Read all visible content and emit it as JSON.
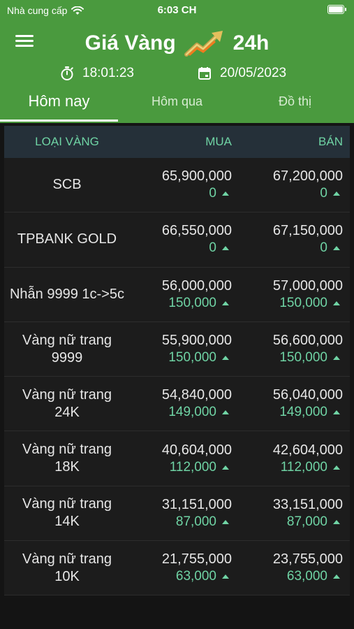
{
  "status_bar": {
    "carrier": "Nhà cung cấp",
    "time": "6:03 CH"
  },
  "header": {
    "title_left": "Giá Vàng",
    "title_right": "24h",
    "clock_time": "18:01:23",
    "date": "20/05/2023"
  },
  "tabs": [
    {
      "label": "Hôm nay"
    },
    {
      "label": "Hôm qua"
    },
    {
      "label": "Đồ thị"
    }
  ],
  "table": {
    "headers": {
      "type": "LOẠI VÀNG",
      "buy": "MUA",
      "sell": "BÁN"
    },
    "rows": [
      {
        "type": "SCB",
        "buy": "65,900,000",
        "buy_change": "0",
        "sell": "67,200,000",
        "sell_change": "0"
      },
      {
        "type": "TPBANK GOLD",
        "buy": "66,550,000",
        "buy_change": "0",
        "sell": "67,150,000",
        "sell_change": "0"
      },
      {
        "type": "Nhẫn 9999 1c->5c",
        "buy": "56,000,000",
        "buy_change": "150,000",
        "sell": "57,000,000",
        "sell_change": "150,000"
      },
      {
        "type": "Vàng nữ trang 9999",
        "buy": "55,900,000",
        "buy_change": "150,000",
        "sell": "56,600,000",
        "sell_change": "150,000"
      },
      {
        "type": "Vàng nữ trang 24K",
        "buy": "54,840,000",
        "buy_change": "149,000",
        "sell": "56,040,000",
        "sell_change": "149,000"
      },
      {
        "type": "Vàng nữ trang 18K",
        "buy": "40,604,000",
        "buy_change": "112,000",
        "sell": "42,604,000",
        "sell_change": "112,000"
      },
      {
        "type": "Vàng nữ trang 14K",
        "buy": "31,151,000",
        "buy_change": "87,000",
        "sell": "33,151,000",
        "sell_change": "87,000"
      },
      {
        "type": "Vàng nữ trang 10K",
        "buy": "21,755,000",
        "buy_change": "63,000",
        "sell": "23,755,000",
        "sell_change": "63,000"
      }
    ]
  },
  "colors": {
    "header_green": "#4a9a3e",
    "accent_teal": "#6fd3a4",
    "background": "#141414",
    "table_header": "#253039"
  },
  "icons": {
    "menu": "menu-icon",
    "stopwatch": "stopwatch-icon",
    "calendar": "calendar-icon",
    "trend": "trend-up-logo",
    "change": "caret-up-icon"
  }
}
